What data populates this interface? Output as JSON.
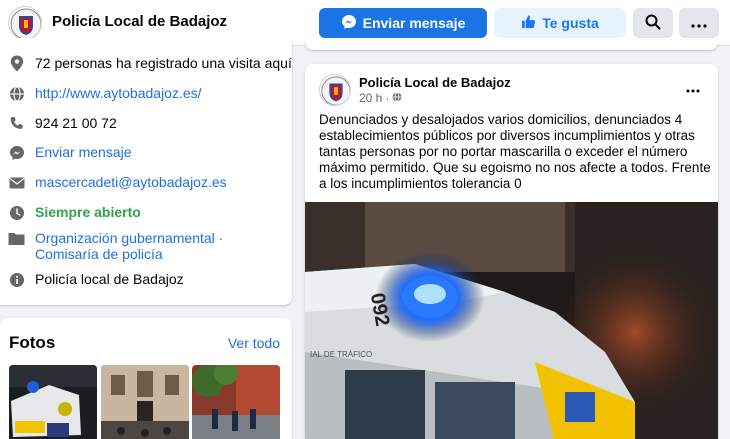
{
  "header": {
    "page_name": "Policía Local de Badajoz",
    "send_message_label": "Enviar mensaje",
    "like_label": "Te gusta"
  },
  "info": {
    "visits": "72 personas ha registrado una visita aquí",
    "website": "http://www.aytobadajoz.es/",
    "phone": "924 21 00 72",
    "message": "Enviar mensaje",
    "email": "mascercadeti@aytobadajoz.es",
    "hours": "Siempre abierto",
    "category_1": "Organización gubernamental",
    "category_sep": " · ",
    "category_2": "Comisaría de policía",
    "about": "Policía local de Badajoz"
  },
  "photos": {
    "title": "Fotos",
    "see_all": "Ver todo"
  },
  "post": {
    "author": "Policía Local de Badajoz",
    "time": "20 h",
    "time_sep": "·",
    "text": "Denunciados y desalojados varios domicilios, denunciados 4 establecimientos públicos por diversos incumplimientos y otras tantas personas por no portar mascarilla o exceder el número máximo permitido. Que su egoismo no nos afecte a todos. Frente a los incumplimientos tolerancia 0",
    "image_car_number": "092",
    "image_car_text": "IAL DE TRÁFICO"
  },
  "colors": {
    "primary": "#1b74e4",
    "link": "#216fdb",
    "open_green": "#31a24c",
    "background": "#f0f2f5"
  },
  "icons": [
    "messenger-icon",
    "thumbs-up-icon",
    "search-icon",
    "more-icon",
    "location-pin-icon",
    "globe-icon",
    "phone-icon",
    "messenger-icon",
    "mail-icon",
    "clock-icon",
    "category-icon",
    "info-icon",
    "globe-small-icon"
  ]
}
